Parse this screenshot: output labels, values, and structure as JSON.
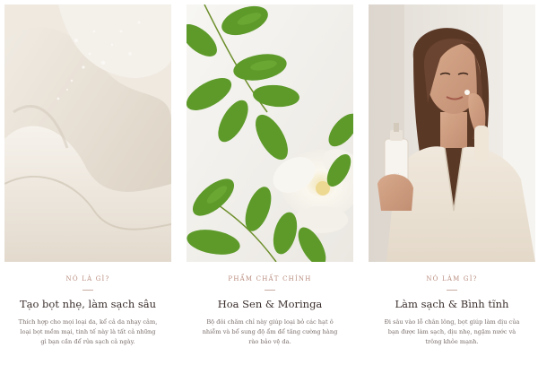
{
  "cards": [
    {
      "image": "foam-texture-image",
      "eyebrow": "NÓ LÀ GÌ?",
      "title": "Tạo bọt nhẹ, làm sạch sâu",
      "body": "Thích hợp cho mọi loại da, kể cả da nhạy cảm, loại bọt mềm mại, tinh tế này là tất cả những gì bạn cần để rửa sạch cả ngày."
    },
    {
      "image": "green-leaves-flower-image",
      "eyebrow": "PHẨM CHẤT CHÍNH",
      "title": "Hoa Sen & Moringa",
      "body": "Bộ đôi chăm chỉ này giúp loại bỏ các hạt ô nhiễm và bổ sung độ ẩm để tăng cường hàng rào bảo vệ da."
    },
    {
      "image": "woman-with-product-image",
      "eyebrow": "NÓ LÀM GÌ?",
      "title": "Làm sạch & Bình tĩnh",
      "body": "Đi sâu vào lỗ chân lông, bọt giúp làm dịu của bạn được làm sạch, dịu nhẹ, ngậm nước và trông khỏe mạnh."
    }
  ],
  "colors": {
    "eyebrow": "#b98c7e",
    "title": "#3a2f2c",
    "body": "#7a6f6b",
    "foam": "#e9e2d8",
    "leaf": "#5d9a2a"
  }
}
